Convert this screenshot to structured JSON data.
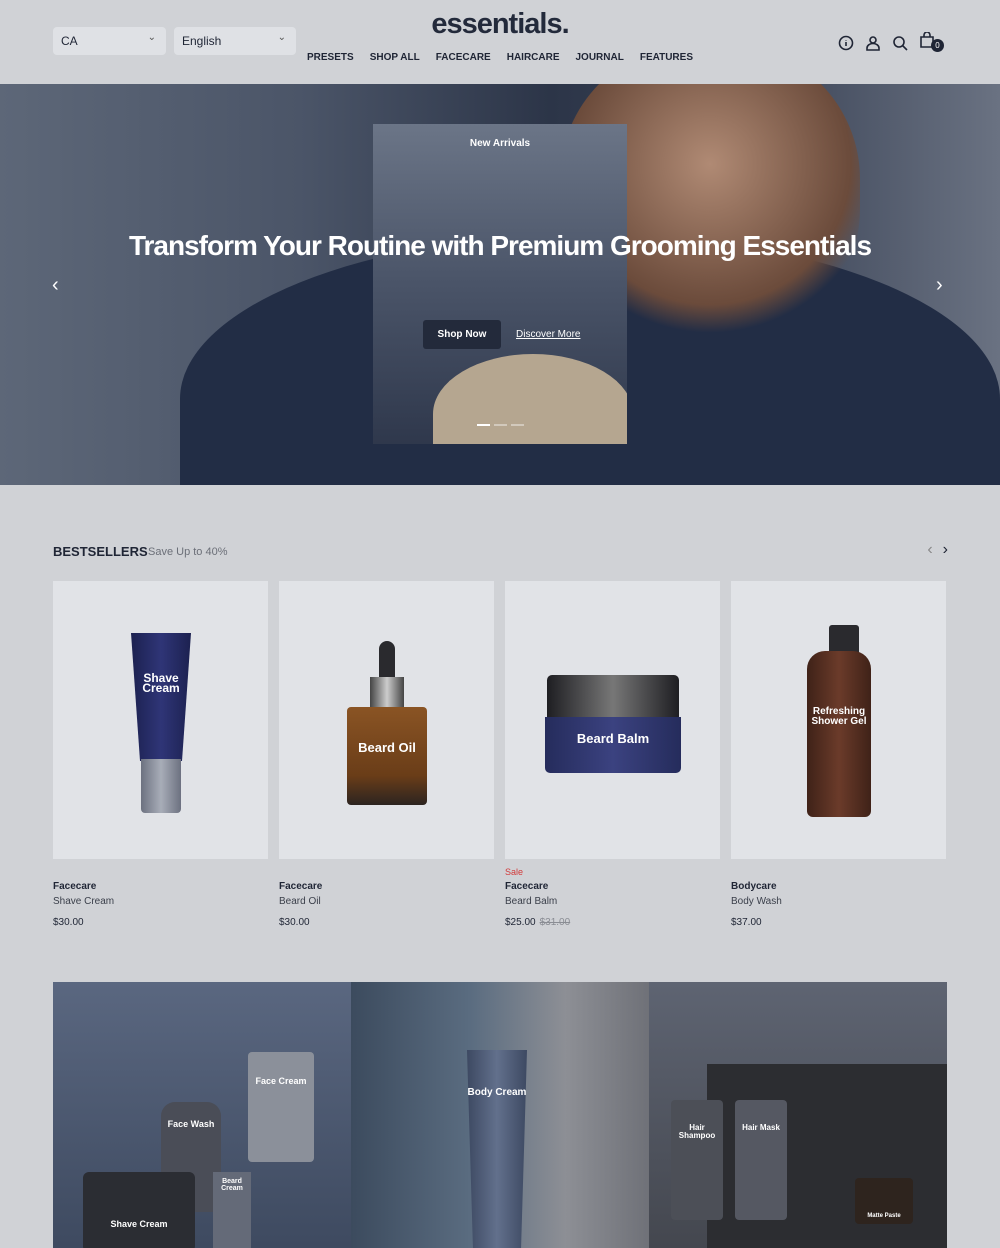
{
  "header": {
    "country": "CA",
    "language": "English",
    "logo": "essentials.",
    "nav": [
      "PRESETS",
      "SHOP ALL",
      "FACECARE",
      "HAIRCARE",
      "JOURNAL",
      "FEATURES"
    ],
    "cart_count": "0"
  },
  "hero": {
    "eyebrow": "New Arrivals",
    "title": "Transform Your Routine with Premium Grooming Essentials",
    "primary_cta": "Shop Now",
    "secondary_cta": "Discover More",
    "slide_count": 3,
    "active_slide": 1
  },
  "bestsellers": {
    "title": "BESTSELLERS",
    "subtitle": "Save Up to 40%",
    "products": [
      {
        "category": "Facecare",
        "name": "Shave Cream",
        "price": "$30.00",
        "sale_label": "",
        "compare_price": "",
        "package_label": "Shave Cream"
      },
      {
        "category": "Facecare",
        "name": "Beard Oil",
        "price": "$30.00",
        "sale_label": "",
        "compare_price": "",
        "package_label": "Beard Oil"
      },
      {
        "category": "Facecare",
        "name": "Beard Balm",
        "price": "$25.00",
        "sale_label": "Sale",
        "compare_price": "$31.00",
        "package_label": "Beard Balm"
      },
      {
        "category": "Bodycare",
        "name": "Body Wash",
        "price": "$37.00",
        "sale_label": "",
        "compare_price": "",
        "package_label": "Refreshing Shower Gel"
      }
    ]
  },
  "banners": {
    "labels": [
      "Face Cream",
      "Face Wash",
      "Beard Cream",
      "Shave Cream",
      "Body Cream",
      "Hair Shampoo",
      "Hair Mask",
      "Matte Paste"
    ]
  },
  "colors": {
    "brand": "#232a3b",
    "sale": "#d23a3a",
    "background": "#d0d2d6"
  }
}
